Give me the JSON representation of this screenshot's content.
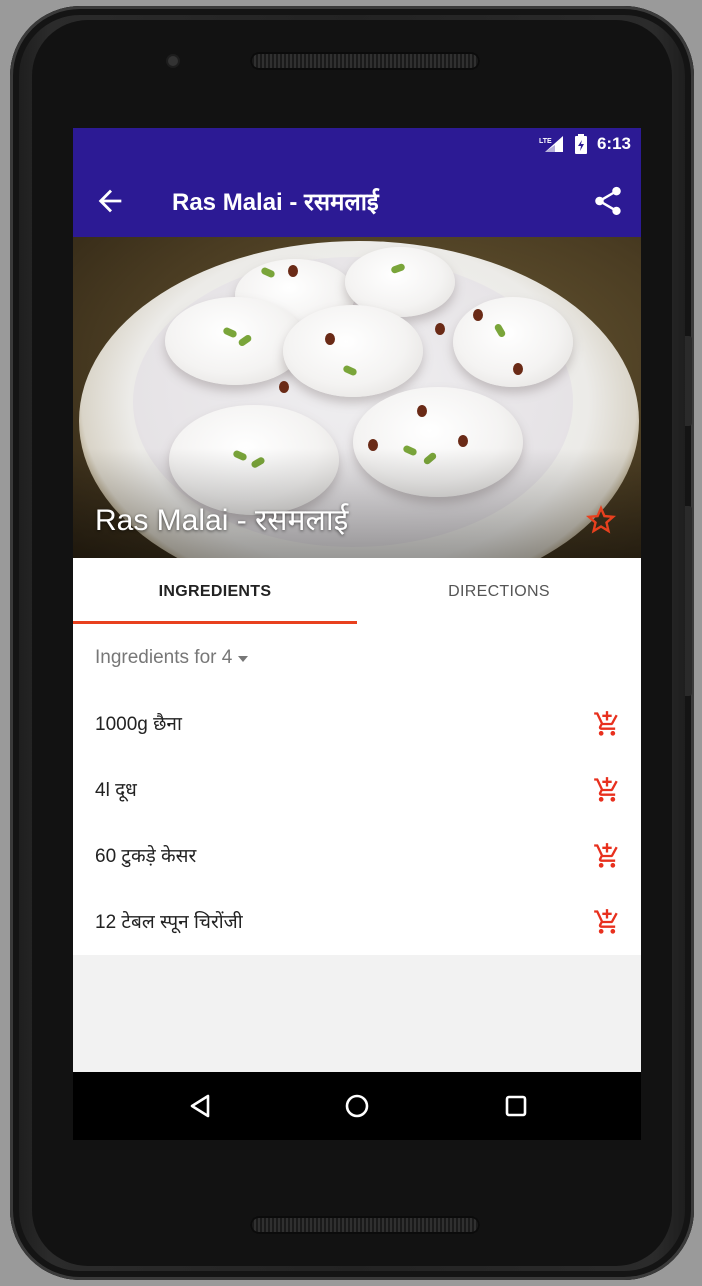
{
  "status_bar": {
    "network_label": "LTE",
    "time": "6:13"
  },
  "app_bar": {
    "title": "Ras Malai - रसमलाई",
    "back_icon": "arrow-back-icon",
    "share_icon": "share-icon"
  },
  "hero": {
    "title": "Ras Malai - रसमलाई",
    "favorite_icon": "star-outline-icon"
  },
  "tabs": [
    {
      "label": "INGREDIENTS",
      "selected": true
    },
    {
      "label": "DIRECTIONS",
      "selected": false
    }
  ],
  "servings": {
    "label": "Ingredients for 4"
  },
  "ingredients": [
    {
      "text": "1000g छैना"
    },
    {
      "text": "4l दूध"
    },
    {
      "text": "60 टुकड़े केसर"
    },
    {
      "text": "12 टेबल स्पून चिरोंजी"
    }
  ],
  "colors": {
    "primary": "#2c1a94",
    "accent": "#e8401e",
    "cart": "#e8301e"
  }
}
